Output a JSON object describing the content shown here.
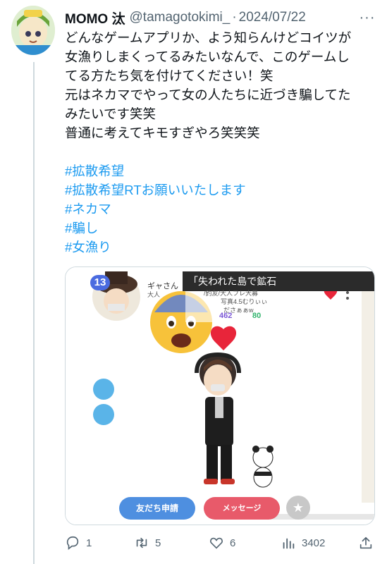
{
  "tweet": {
    "author_name": "MOMO 汰",
    "handle": "@tamagotokimi_",
    "separator": "·",
    "date": "2024/07/22",
    "more_label": "···",
    "body_lines": [
      "どんなゲームアプリか、よう知らんけどコイツが",
      "女漁りしまくってるみたいなんで、このゲームし",
      "てる方たち気を付けてください！笑",
      "元はネカマでやって女の人たちに近づき騙してた",
      "みたいです笑笑",
      "普通に考えてキモすぎやろ笑笑笑"
    ],
    "hashtags": [
      "#拡散希望",
      "#拡散希望RTお願いいたします",
      "#ネカマ",
      "#騙し",
      "#女漁り"
    ]
  },
  "media": {
    "banner_text": "「失われた島で鉱石",
    "level": "13",
    "profile_name": "ギャさん",
    "profile_lines": [
      "大人",
      "/釣友/大人フレ大募",
      "写真4.5むりぃぃ",
      "ださぁぁw"
    ],
    "likes_count": "462",
    "stars_count": "80",
    "friend_request_label": "友だち申請",
    "message_label": "メッセージ"
  },
  "actions": {
    "replies": "1",
    "retweets": "5",
    "likes": "6",
    "views": "3402"
  },
  "colors": {
    "link": "#1d9bf0",
    "muted": "#536471",
    "text": "#0f1419",
    "divider": "#cfd9de"
  },
  "icons": [
    "more-icon",
    "reply-icon",
    "retweet-icon",
    "like-icon",
    "views-icon",
    "share-icon",
    "scared-emoji-icon",
    "heart-icon",
    "star-icon"
  ]
}
